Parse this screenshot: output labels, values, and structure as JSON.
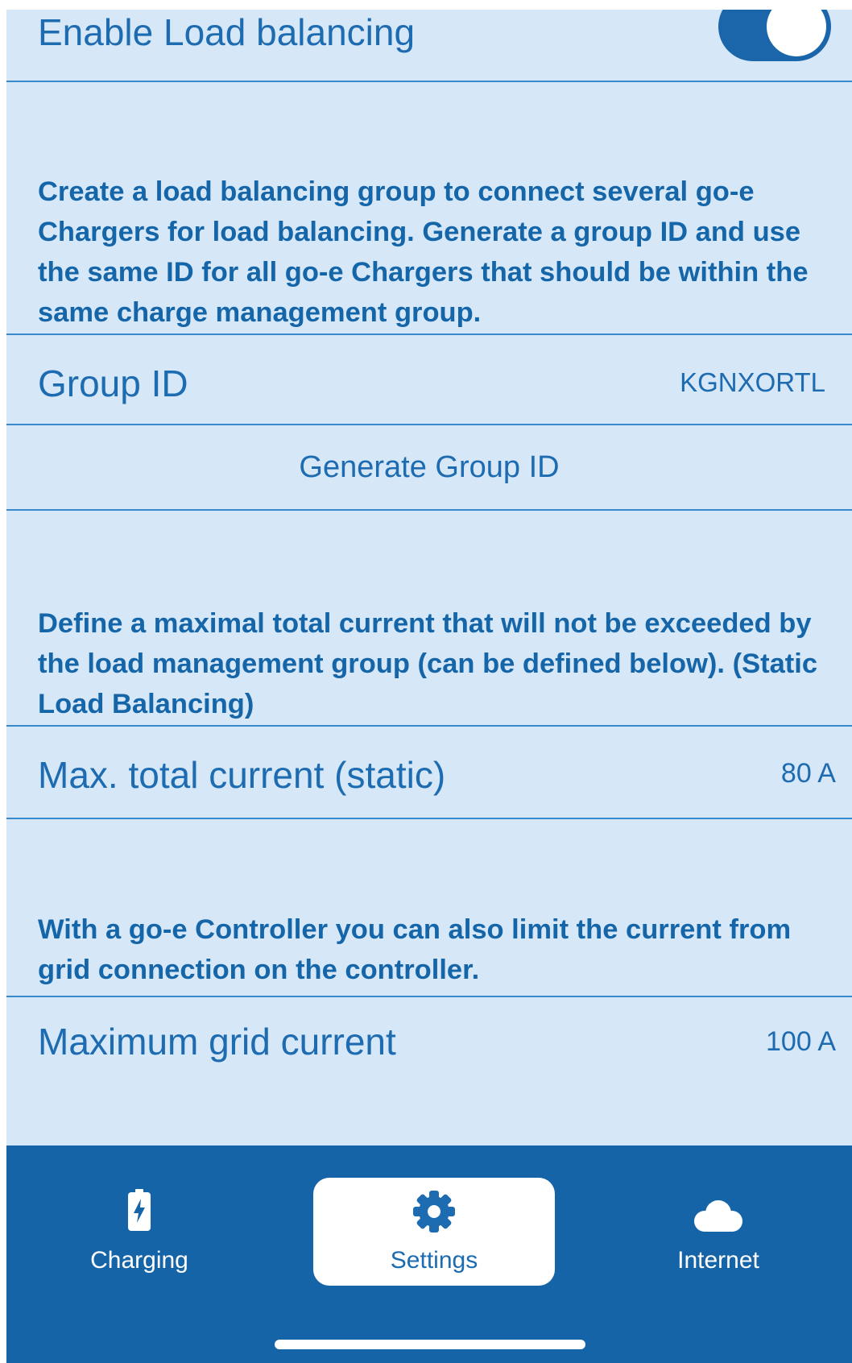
{
  "load_balancing": {
    "enable_label": "Enable Load balancing",
    "enabled": true,
    "group_description": "Create a load balancing group to connect several go-e Chargers for load balancing. Generate a group ID and use the same ID for all go-e Chargers that should be within the same charge management group.",
    "group_id_label": "Group ID",
    "group_id_value": "KGNXORTL",
    "generate_button_label": "Generate Group ID",
    "static_description": "Define a maximal total current that will not be exceeded by the load management group (can be defined below). (Static Load Balancing)",
    "max_total_current_label": "Max. total current (static)",
    "max_total_current_value": "80 A",
    "controller_description": "With a go-e Controller you can also limit the current from grid connection on the controller.",
    "max_grid_current_label": "Maximum grid current",
    "max_grid_current_value": "100 A"
  },
  "tabbar": {
    "active": "settings",
    "items": [
      {
        "id": "charging",
        "label": "Charging",
        "icon": "battery-charging-icon"
      },
      {
        "id": "settings",
        "label": "Settings",
        "icon": "gear-icon"
      },
      {
        "id": "internet",
        "label": "Internet",
        "icon": "cloud-icon"
      }
    ]
  },
  "colors": {
    "background": "#d6e7f8",
    "accent": "#1b65aa",
    "text": "#1d6bb0",
    "tabbar": "#1564a8"
  }
}
